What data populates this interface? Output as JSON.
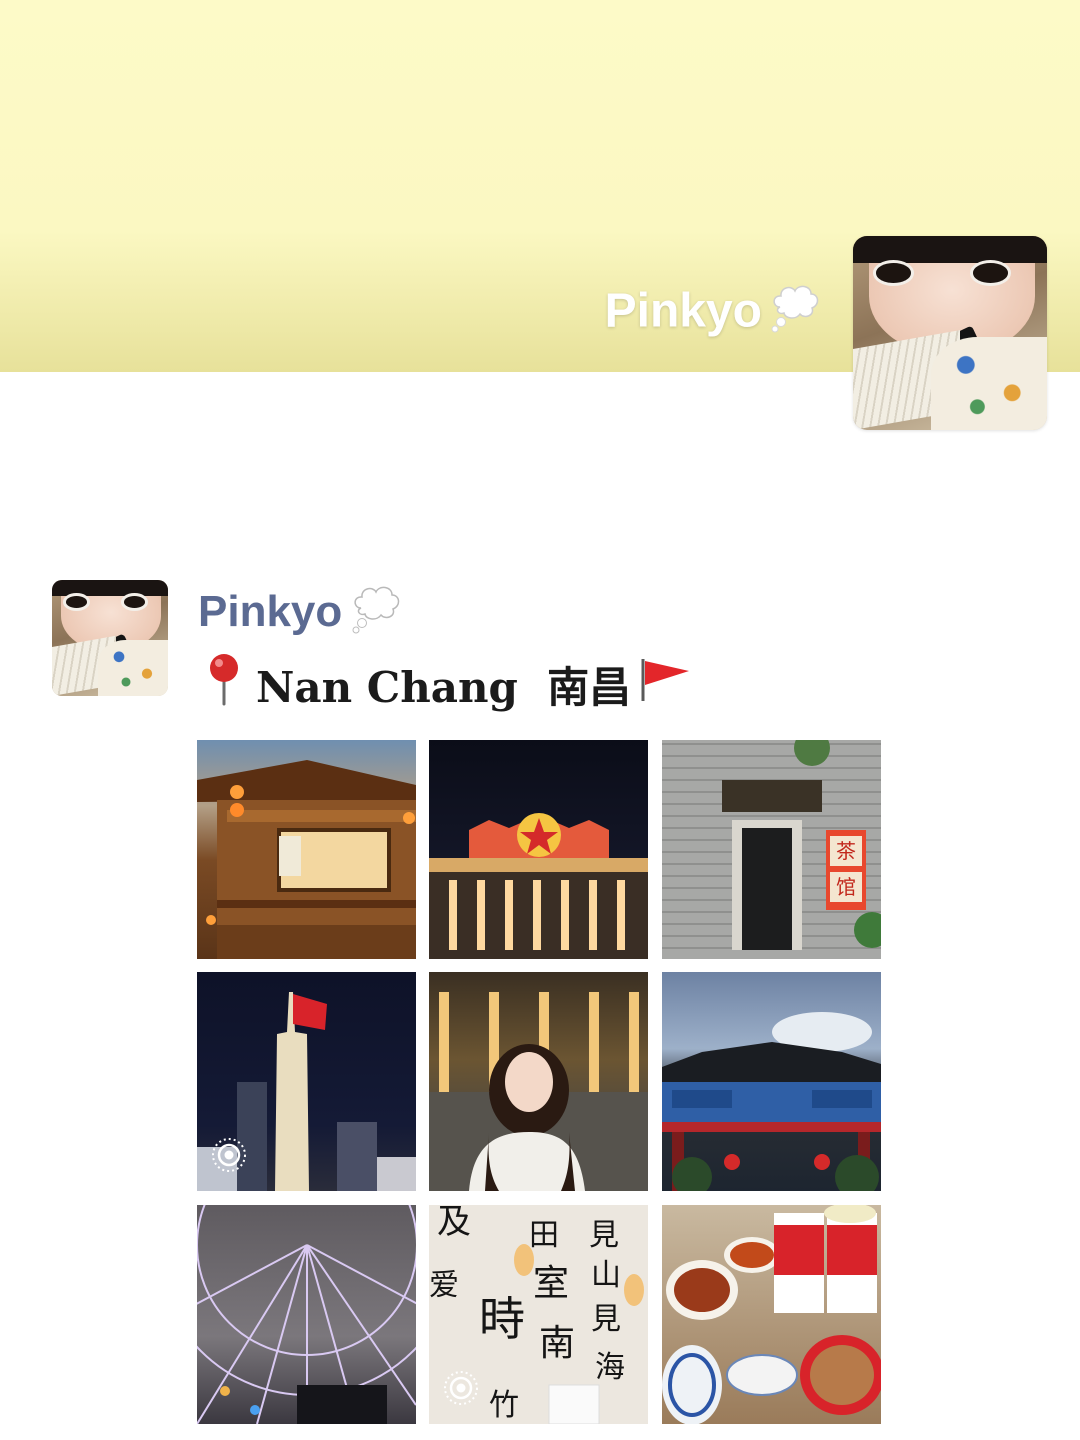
{
  "cover": {
    "username": "Pinkyo"
  },
  "post": {
    "username": "Pinkyo",
    "location_text": "Nan Chang  南昌"
  },
  "photos": [
    {
      "name": "photo-tea-house-night",
      "live": false
    },
    {
      "name": "photo-memorial-hall-night",
      "live": false
    },
    {
      "name": "photo-old-gate-tea-shop",
      "live": false,
      "sign": "茶馆"
    },
    {
      "name": "photo-monument-tower",
      "live": true
    },
    {
      "name": "photo-portrait-girl",
      "live": false
    },
    {
      "name": "photo-archway",
      "live": false
    },
    {
      "name": "photo-ferris-wheel",
      "live": false
    },
    {
      "name": "photo-calligraphy-wall",
      "live": true
    },
    {
      "name": "photo-food-table",
      "live": false
    }
  ],
  "colors": {
    "cover_top": "#fdfac8",
    "cover_bottom": "#e7e19a",
    "username_link": "#5b6a92",
    "flag_red": "#e3262a",
    "pin_red": "#d62a2a"
  },
  "icons": {
    "thought": "thought-bubble-icon",
    "pin": "round-pushpin-icon",
    "flag": "triangular-flag-icon",
    "live": "live-photo-icon"
  }
}
